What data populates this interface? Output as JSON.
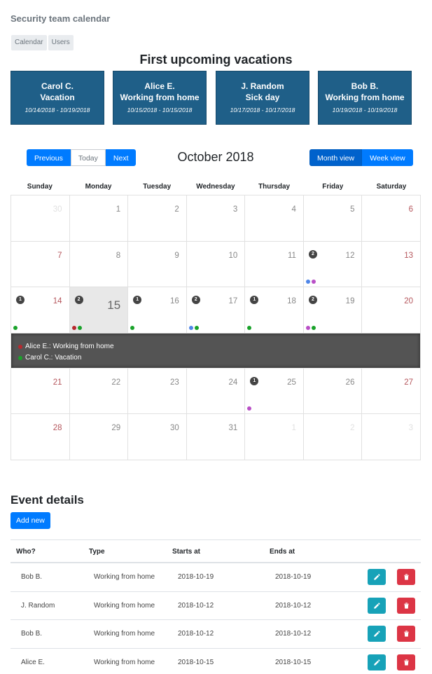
{
  "app": {
    "title": "Security team calendar"
  },
  "nav": {
    "calendar": "Calendar",
    "users": "Users"
  },
  "upcoming": {
    "title": "First upcoming vacations",
    "cards": [
      {
        "name": "Carol C.",
        "type": "Vacation",
        "dates": "10/14/2018 - 10/19/2018"
      },
      {
        "name": "Alice E.",
        "type": "Working from home",
        "dates": "10/15/2018 - 10/15/2018"
      },
      {
        "name": "J. Random",
        "type": "Sick day",
        "dates": "10/17/2018 - 10/17/2018"
      },
      {
        "name": "Bob B.",
        "type": "Working from home",
        "dates": "10/19/2018 - 10/19/2018"
      }
    ]
  },
  "calendar": {
    "prev": "Previous",
    "today": "Today",
    "next": "Next",
    "title": "October 2018",
    "month_view": "Month view",
    "week_view": "Week view",
    "weekdays": [
      "Sunday",
      "Monday",
      "Tuesday",
      "Wednesday",
      "Thursday",
      "Friday",
      "Saturday"
    ],
    "colors": {
      "red": "#b7282e",
      "green": "#19a22a",
      "blue": "#4f86e8",
      "purple": "#b94fc6"
    },
    "weeks": [
      [
        {
          "day": "30",
          "out": true
        },
        {
          "day": "1"
        },
        {
          "day": "2"
        },
        {
          "day": "3"
        },
        {
          "day": "4"
        },
        {
          "day": "5"
        },
        {
          "day": "6"
        }
      ],
      [
        {
          "day": "7"
        },
        {
          "day": "8"
        },
        {
          "day": "9"
        },
        {
          "day": "10"
        },
        {
          "day": "11"
        },
        {
          "day": "12",
          "count": "2",
          "dots": [
            "blue",
            "purple"
          ]
        },
        {
          "day": "13"
        }
      ],
      [
        {
          "day": "14",
          "count": "1",
          "dots": [
            "green"
          ]
        },
        {
          "day": "15",
          "count": "2",
          "dots": [
            "red",
            "green"
          ],
          "today": true
        },
        {
          "day": "16",
          "count": "1",
          "dots": [
            "green"
          ]
        },
        {
          "day": "17",
          "count": "2",
          "dots": [
            "blue",
            "green"
          ]
        },
        {
          "day": "18",
          "count": "1",
          "dots": [
            "green"
          ]
        },
        {
          "day": "19",
          "count": "2",
          "dots": [
            "purple",
            "green"
          ]
        },
        {
          "day": "20"
        }
      ],
      [
        {
          "day": "21"
        },
        {
          "day": "22"
        },
        {
          "day": "23"
        },
        {
          "day": "24"
        },
        {
          "day": "25",
          "count": "1",
          "dots": [
            "purple"
          ]
        },
        {
          "day": "26"
        },
        {
          "day": "27"
        }
      ],
      [
        {
          "day": "28"
        },
        {
          "day": "29"
        },
        {
          "day": "30"
        },
        {
          "day": "31"
        },
        {
          "day": "1",
          "out": true
        },
        {
          "day": "2",
          "out": true
        },
        {
          "day": "3",
          "out": true
        }
      ]
    ],
    "slide_events": [
      {
        "color": "red",
        "text": "Alice E.: Working from home"
      },
      {
        "color": "green",
        "text": "Carol C.: Vacation"
      }
    ]
  },
  "details": {
    "title": "Event details",
    "add_new": "Add new",
    "headers": {
      "who": "Who?",
      "type": "Type",
      "starts": "Starts at",
      "ends": "Ends at"
    },
    "rows": [
      {
        "who": "Bob B.",
        "type": "Working from home",
        "starts": "2018-10-19",
        "ends": "2018-10-19"
      },
      {
        "who": "J. Random",
        "type": "Working from home",
        "starts": "2018-10-12",
        "ends": "2018-10-12"
      },
      {
        "who": "Bob B.",
        "type": "Working from home",
        "starts": "2018-10-12",
        "ends": "2018-10-12"
      },
      {
        "who": "Alice E.",
        "type": "Working from home",
        "starts": "2018-10-15",
        "ends": "2018-10-15"
      }
    ]
  }
}
